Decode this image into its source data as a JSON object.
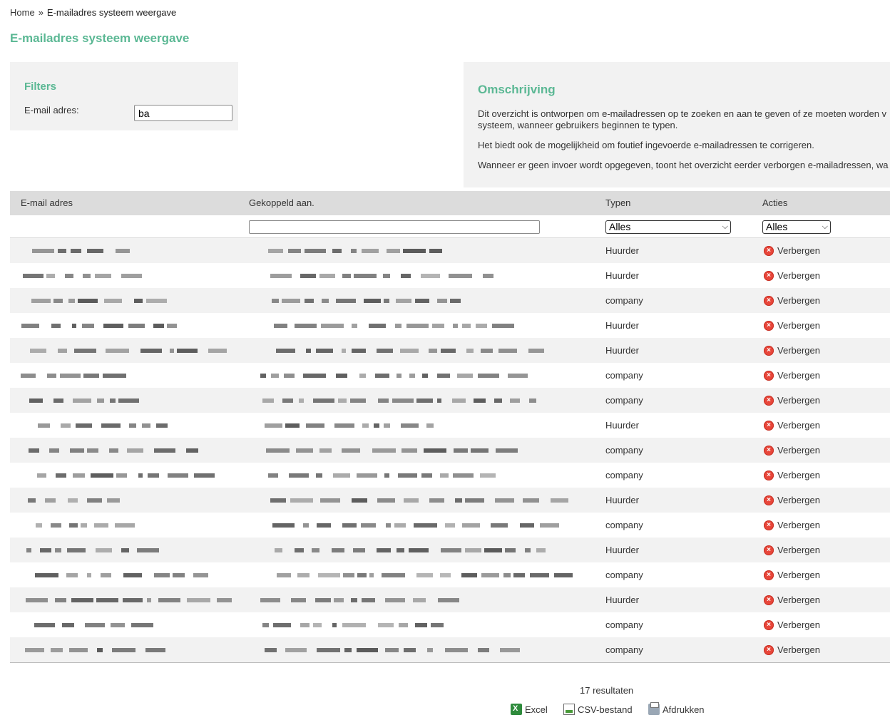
{
  "breadcrumb": {
    "home": "Home",
    "separator": "»",
    "current": "E-mailadres systeem weergave"
  },
  "page_title": "E-mailadres systeem weergave",
  "filters": {
    "title": "Filters",
    "email_label": "E-mail adres:",
    "email_value": "ba"
  },
  "description": {
    "title": "Omschrijving",
    "paragraph1": "Dit overzicht is ontworpen om e-mailadressen op te zoeken en aan te geven of ze moeten worden v systeem, wanneer gebruikers beginnen te typen.",
    "paragraph2": "Het biedt ook de mogelijkheid om foutief ingevoerde e-mailadressen te corrigeren.",
    "paragraph3": "Wanneer er geen invoer wordt opgegeven, toont het overzicht eerder verborgen e-mailadressen, wa"
  },
  "table": {
    "headers": {
      "email": "E-mail adres",
      "linked": "Gekoppeld aan.",
      "types": "Typen",
      "actions": "Acties"
    },
    "column_filters": {
      "linked_value": "",
      "types_selected": "Alles",
      "actions_selected": "Alles"
    },
    "action_label": "Verbergen",
    "rows": [
      {
        "type": "Huurder"
      },
      {
        "type": "Huurder"
      },
      {
        "type": "company"
      },
      {
        "type": "Huurder"
      },
      {
        "type": "Huurder"
      },
      {
        "type": "company"
      },
      {
        "type": "company"
      },
      {
        "type": "Huurder"
      },
      {
        "type": "company"
      },
      {
        "type": "company"
      },
      {
        "type": "Huurder"
      },
      {
        "type": "company"
      },
      {
        "type": "Huurder"
      },
      {
        "type": "company"
      },
      {
        "type": "Huurder"
      },
      {
        "type": "company"
      },
      {
        "type": "company"
      }
    ]
  },
  "results_text": "17 resultaten",
  "exports": {
    "excel": "Excel",
    "csv": "CSV-bestand",
    "print": "Afdrukken"
  },
  "icons": {
    "hide": "remove-circle-icon",
    "excel": "excel-icon",
    "csv": "csv-file-icon",
    "print": "printer-icon"
  },
  "colors": {
    "accent": "#5bb894",
    "header_bg": "#dcdcdc",
    "panel_bg": "#f2f2f2",
    "hide_icon": "#e8463a"
  }
}
